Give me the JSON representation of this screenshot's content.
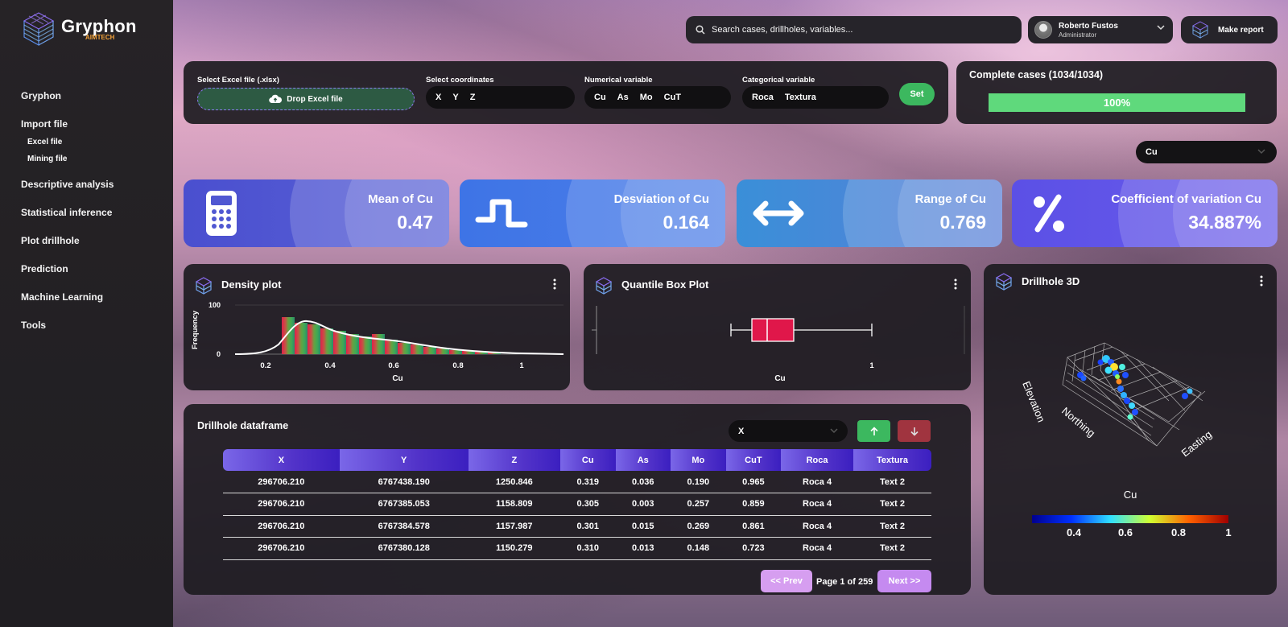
{
  "app": {
    "name": "Gryphon",
    "sub": "AIMTECH"
  },
  "sidebar": {
    "items": [
      {
        "label": "Gryphon"
      },
      {
        "label": "Import file",
        "subs": [
          "Excel file",
          "Mining file"
        ]
      },
      {
        "label": "Descriptive analysis"
      },
      {
        "label": "Statistical inference"
      },
      {
        "label": "Plot drillhole"
      },
      {
        "label": "Prediction"
      },
      {
        "label": "Machine Learning"
      },
      {
        "label": "Tools"
      }
    ]
  },
  "header": {
    "search_placeholder": "Search cases, drillholes, variables...",
    "user_name": "Roberto Fustos",
    "user_role": "Administrator",
    "report_label": "Make report"
  },
  "controls": {
    "excel_label": "Select Excel file (.xlsx)",
    "drop_label": "Drop Excel file",
    "coords_label": "Select coordinates",
    "coords": [
      "X",
      "Y",
      "Z"
    ],
    "num_label": "Numerical variable",
    "num_vars": [
      "Cu",
      "As",
      "Mo",
      "CuT"
    ],
    "cat_label": "Categorical variable",
    "cat_vars": [
      "Roca",
      "Textura"
    ],
    "set_label": "Set"
  },
  "complete": {
    "title": "Complete cases (1034/1034)",
    "progress_text": "100%",
    "progress": 1.0
  },
  "variable_select": "Cu",
  "stats": [
    {
      "label": "Mean of Cu",
      "value": "0.47",
      "icon": "calculator-icon",
      "from": "#4a4fcf",
      "to": "#5a62d6"
    },
    {
      "label": "Desviation of Cu",
      "value": "0.164",
      "icon": "wave-icon",
      "from": "#3e74e6",
      "to": "#4c7ee8"
    },
    {
      "label": "Range of Cu",
      "value": "0.769",
      "icon": "arrows-icon",
      "from": "#3a8fd8",
      "to": "#5a7fd8"
    },
    {
      "label": "Coefficient of variation Cu",
      "value": "34.887%",
      "icon": "percent-icon",
      "from": "#5b50e6",
      "to": "#6a5cea"
    }
  ],
  "density": {
    "title": "Density plot",
    "ylabel": "Frequency",
    "xlabel": "Cu",
    "yticks": [
      "100",
      "0"
    ],
    "xticks": [
      "0.2",
      "0.4",
      "0.6",
      "0.8",
      "1"
    ]
  },
  "boxplot": {
    "title": "Quantile Box Plot",
    "xlabel": "Cu",
    "tick": "1"
  },
  "drillhole3d": {
    "title": "Drillhole 3D",
    "axes": [
      "Elevation",
      "Northing",
      "Easting"
    ],
    "colorbar_title": "Cu",
    "colorbar_ticks": [
      "0.4",
      "0.6",
      "0.8",
      "1"
    ]
  },
  "dataframe": {
    "title": "Drillhole dataframe",
    "sort_column": "X",
    "columns": [
      "X",
      "Y",
      "Z",
      "Cu",
      "As",
      "Mo",
      "CuT",
      "Roca",
      "Textura"
    ],
    "rows": [
      [
        "296706.210",
        "6767438.190",
        "1250.846",
        "0.319",
        "0.036",
        "0.190",
        "0.965",
        "Roca 4",
        "Text 2"
      ],
      [
        "296706.210",
        "6767385.053",
        "1158.809",
        "0.305",
        "0.003",
        "0.257",
        "0.859",
        "Roca 4",
        "Text 2"
      ],
      [
        "296706.210",
        "6767384.578",
        "1157.987",
        "0.301",
        "0.015",
        "0.269",
        "0.861",
        "Roca 4",
        "Text 2"
      ],
      [
        "296706.210",
        "6767380.128",
        "1150.279",
        "0.310",
        "0.013",
        "0.148",
        "0.723",
        "Roca 4",
        "Text 2"
      ]
    ],
    "prev_label": "<< Prev",
    "page_label": "Page 1 of 259",
    "next_label": "Next >>"
  }
}
